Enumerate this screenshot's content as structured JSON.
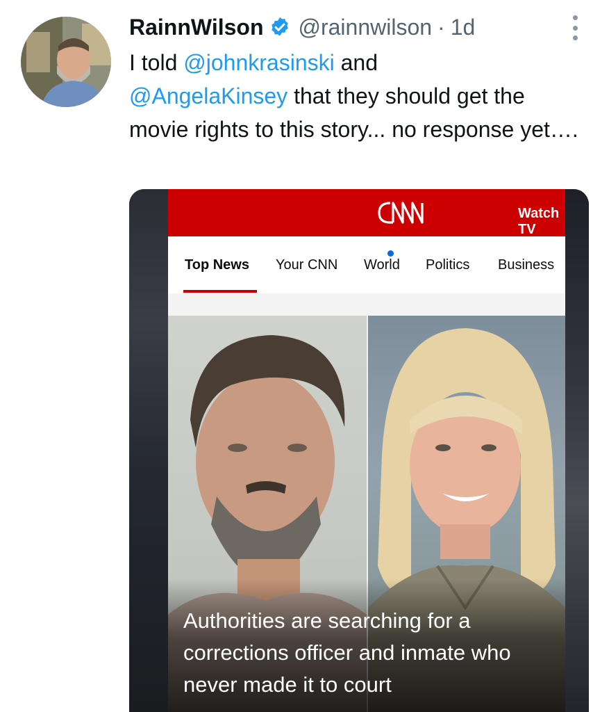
{
  "tweet": {
    "display_name": "RainnWilson",
    "handle": "@rainnwilson",
    "separator": "·",
    "time": "1d",
    "text_parts": {
      "t1": "I told ",
      "m1": "@johnkrasinski",
      "t2": " and ",
      "m2": "@AngelaKinsey",
      "t3": " that they should get the movie rights to this story... no response yet…."
    }
  },
  "media": {
    "watch_tv": "Watch TV",
    "nav": [
      "Top News",
      "Your CNN",
      "World",
      "Politics",
      "Business"
    ],
    "caption": "Authorities are searching for a corrections officer and inmate who never made it to court"
  },
  "colors": {
    "cnn_red": "#cc0000",
    "mention_blue": "#1d9bf0",
    "secondary_text": "#536471"
  },
  "icons": {
    "verified": "verified-badge-icon",
    "more": "more-options-icon",
    "logo": "cnn-logo"
  }
}
